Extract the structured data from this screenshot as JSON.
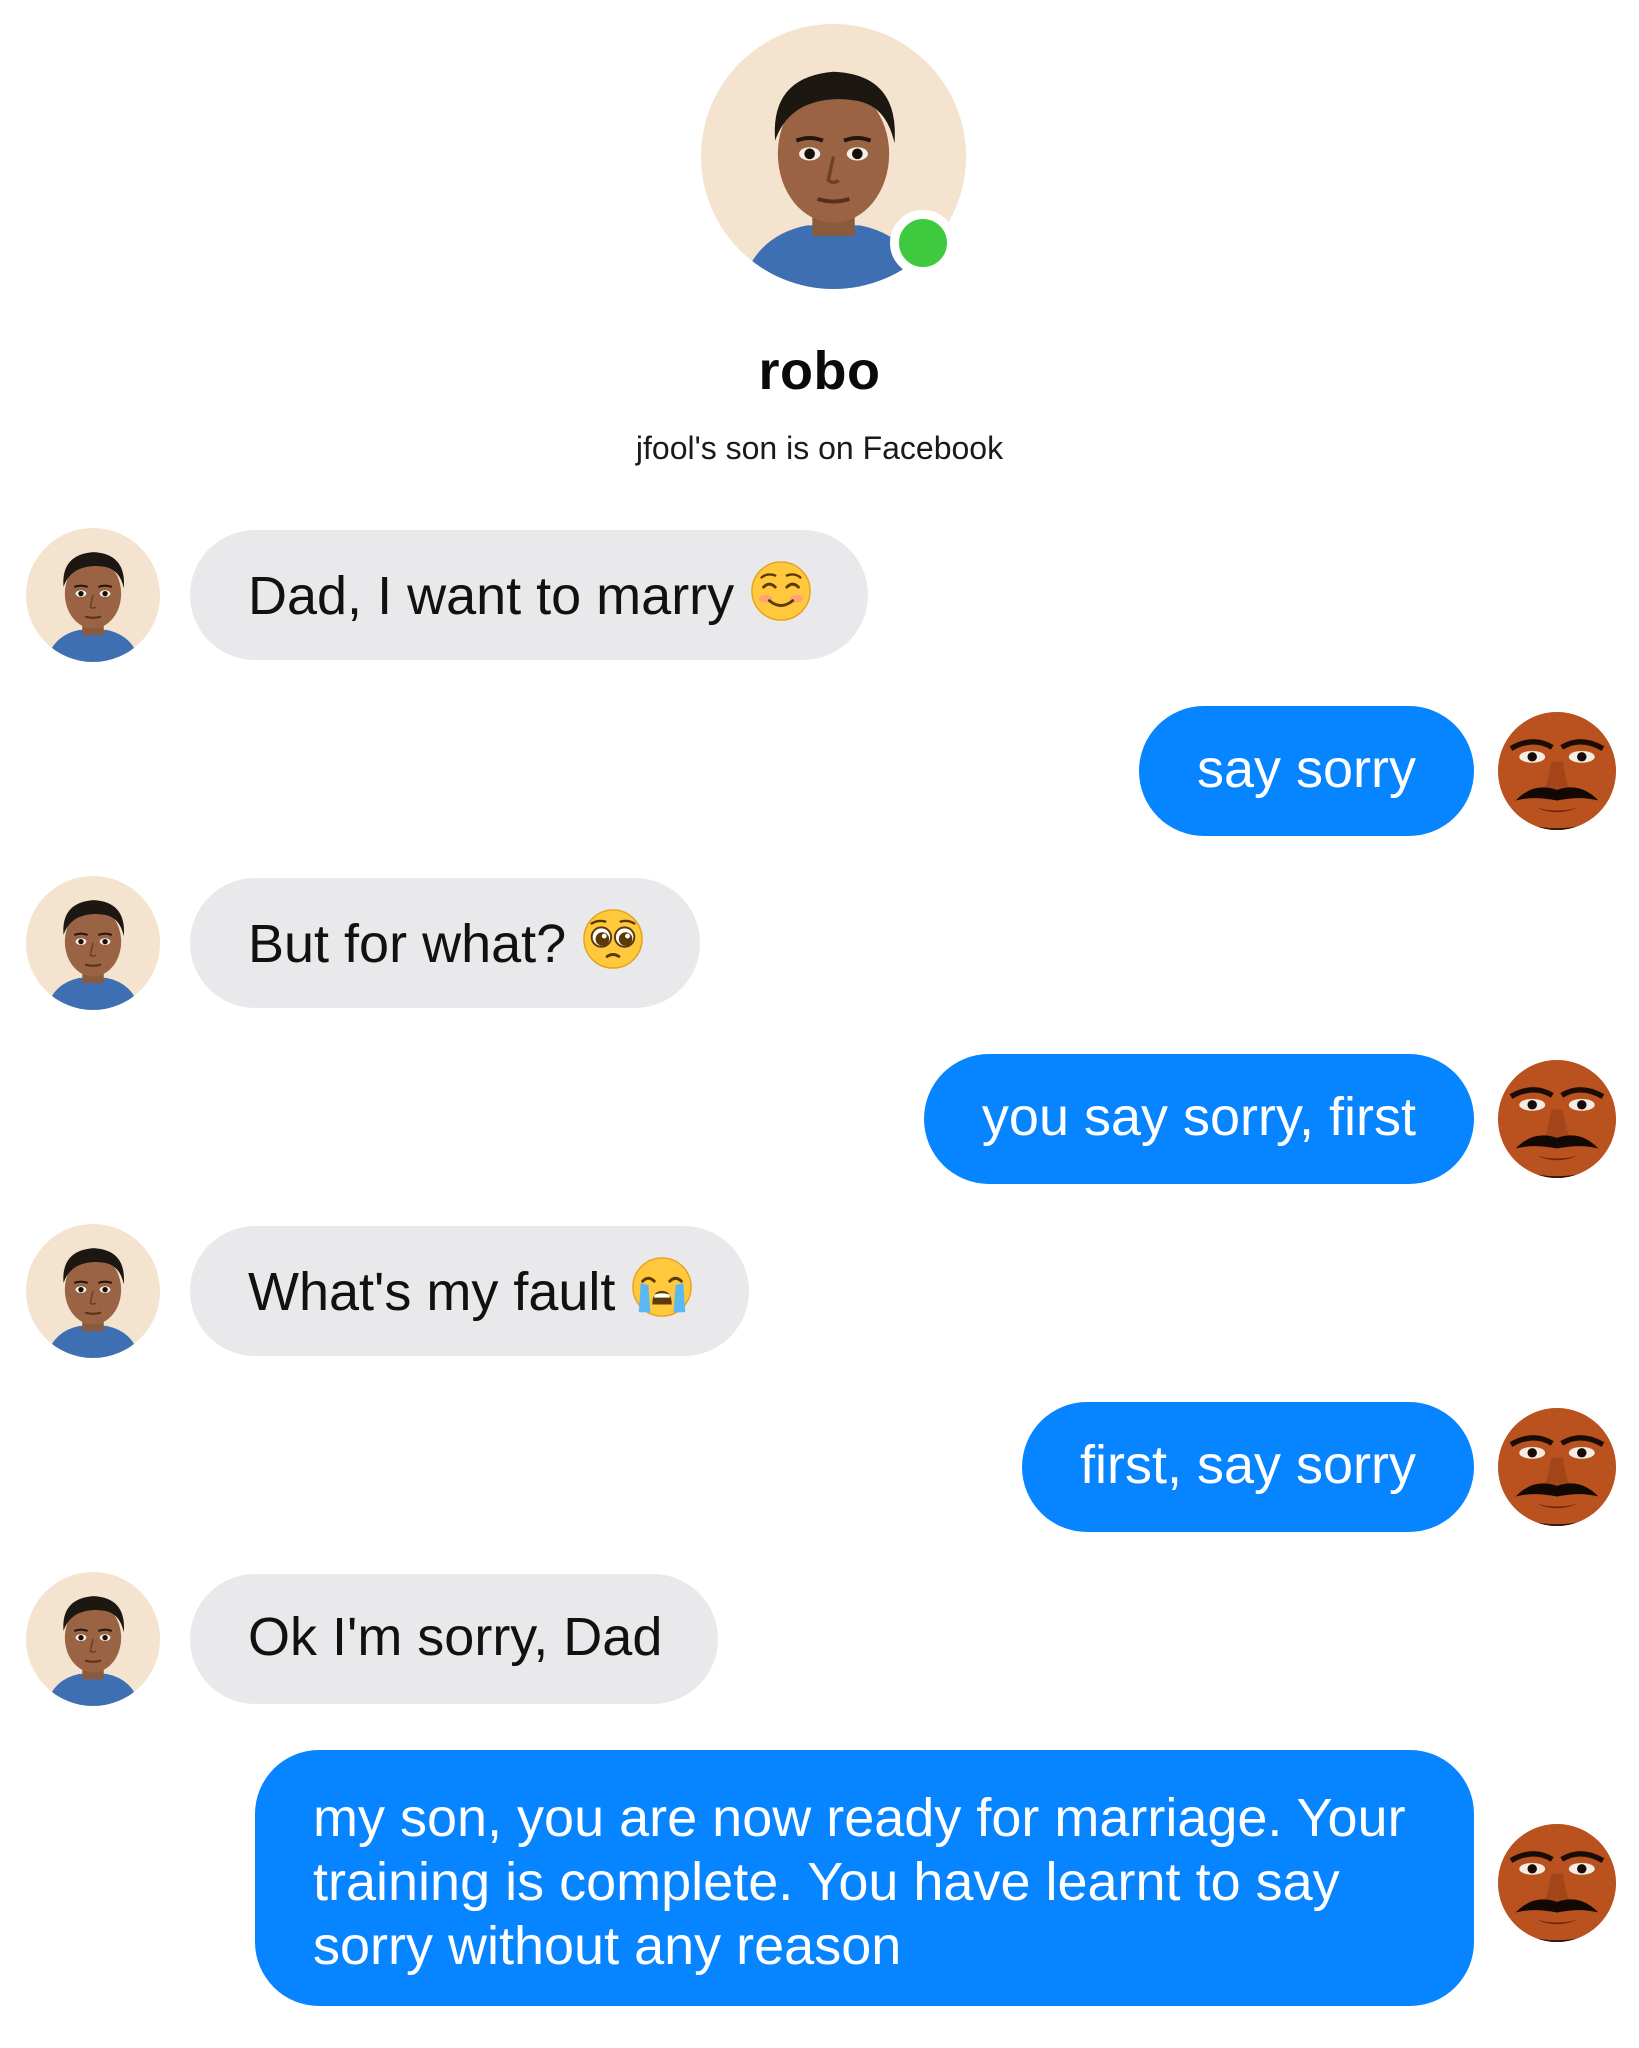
{
  "profile": {
    "name": "robo",
    "subtitle": "jfool's son is on Facebook",
    "online": true,
    "online_color": "#3ec93e",
    "avatar": "boy-portrait-avatar"
  },
  "colors": {
    "incoming_bubble": "#e9e9eb",
    "outgoing_bubble": "#0784ff",
    "outgoing_text": "#ffffff"
  },
  "messages": [
    {
      "sender": "son",
      "text": "Dad, I want to marry",
      "emoji": "smiling-face-emoji"
    },
    {
      "sender": "dad",
      "text": "say sorry"
    },
    {
      "sender": "son",
      "text": "But for what?",
      "emoji": "pleading-face-emoji"
    },
    {
      "sender": "dad",
      "text": "you say sorry, first"
    },
    {
      "sender": "son",
      "text": "What's my fault",
      "emoji": "crying-face-emoji"
    },
    {
      "sender": "dad",
      "text": "first, say sorry"
    },
    {
      "sender": "son",
      "text": "Ok I'm sorry, Dad"
    },
    {
      "sender": "dad",
      "text": "my son, you are now ready for marriage. Your training is complete. You have learnt to say sorry without any reason"
    }
  ]
}
